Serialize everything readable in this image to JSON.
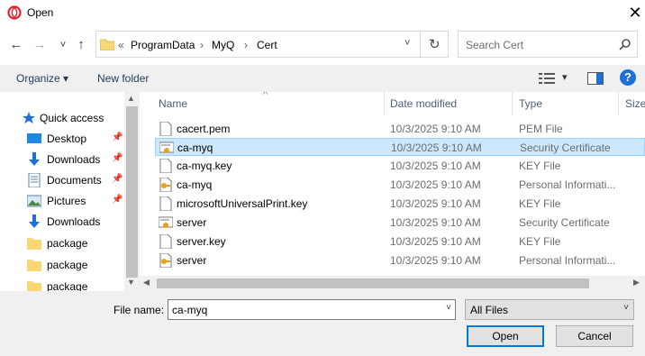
{
  "window": {
    "title": "Open",
    "app_icon": "opera-icon",
    "close_symbol": "✕"
  },
  "nav": {
    "back": "←",
    "forward": "→",
    "recent": "˅",
    "up": "↑",
    "address": {
      "overflow": "«",
      "segments": [
        "ProgramData",
        "MyQ",
        "Cert"
      ],
      "separator": "›",
      "dropdown": "˅"
    },
    "refresh": "↻",
    "search_placeholder": "Search Cert"
  },
  "toolbar": {
    "organize": "Organize ▾",
    "new_folder": "New folder",
    "view_glyph": "▾",
    "help": "?"
  },
  "sidebar": {
    "items": [
      {
        "label": "Quick access",
        "icon": "star-icon",
        "pinned": false
      },
      {
        "label": "Desktop",
        "icon": "desktop-icon",
        "pinned": true
      },
      {
        "label": "Downloads",
        "icon": "download-icon",
        "pinned": true
      },
      {
        "label": "Documents",
        "icon": "documents-icon",
        "pinned": true
      },
      {
        "label": "Pictures",
        "icon": "pictures-icon",
        "pinned": true
      },
      {
        "label": "Downloads",
        "icon": "download-icon",
        "pinned": false
      },
      {
        "label": "package",
        "icon": "folder-icon",
        "pinned": false
      },
      {
        "label": "package",
        "icon": "folder-icon",
        "pinned": false
      },
      {
        "label": "package",
        "icon": "folder-icon",
        "pinned": false
      }
    ],
    "pin_glyph": "📌"
  },
  "columns": {
    "name": "Name",
    "date": "Date modified",
    "type": "Type",
    "size": "Size",
    "sort_glyph": "^"
  },
  "files": [
    {
      "name": "cacert.pem",
      "date": "10/3/2025 9:10 AM",
      "type": "PEM File",
      "icon": "file-icon",
      "selected": false
    },
    {
      "name": "ca-myq",
      "date": "10/3/2025 9:10 AM",
      "type": "Security Certificate",
      "icon": "certificate-icon",
      "selected": true
    },
    {
      "name": "ca-myq.key",
      "date": "10/3/2025 9:10 AM",
      "type": "KEY File",
      "icon": "file-icon",
      "selected": false
    },
    {
      "name": "ca-myq",
      "date": "10/3/2025 9:10 AM",
      "type": "Personal Informati...",
      "icon": "pfx-icon",
      "selected": false
    },
    {
      "name": "microsoftUniversalPrint.key",
      "date": "10/3/2025 9:10 AM",
      "type": "KEY File",
      "icon": "file-icon",
      "selected": false
    },
    {
      "name": "server",
      "date": "10/3/2025 9:10 AM",
      "type": "Security Certificate",
      "icon": "certificate-icon",
      "selected": false
    },
    {
      "name": "server.key",
      "date": "10/3/2025 9:10 AM",
      "type": "KEY File",
      "icon": "file-icon",
      "selected": false
    },
    {
      "name": "server",
      "date": "10/3/2025 9:10 AM",
      "type": "Personal Informati...",
      "icon": "pfx-icon",
      "selected": false
    }
  ],
  "footer": {
    "filename_label": "File name:",
    "filename_value": "ca-myq",
    "filter_value": "All Files",
    "open": "Open",
    "cancel": "Cancel",
    "dropdown": "˅"
  },
  "colors": {
    "selection": "#cce8ff",
    "selection_border": "#99d1ff",
    "accent": "#0078d7",
    "folder": "#f8d775",
    "help": "#1e6fd9"
  }
}
